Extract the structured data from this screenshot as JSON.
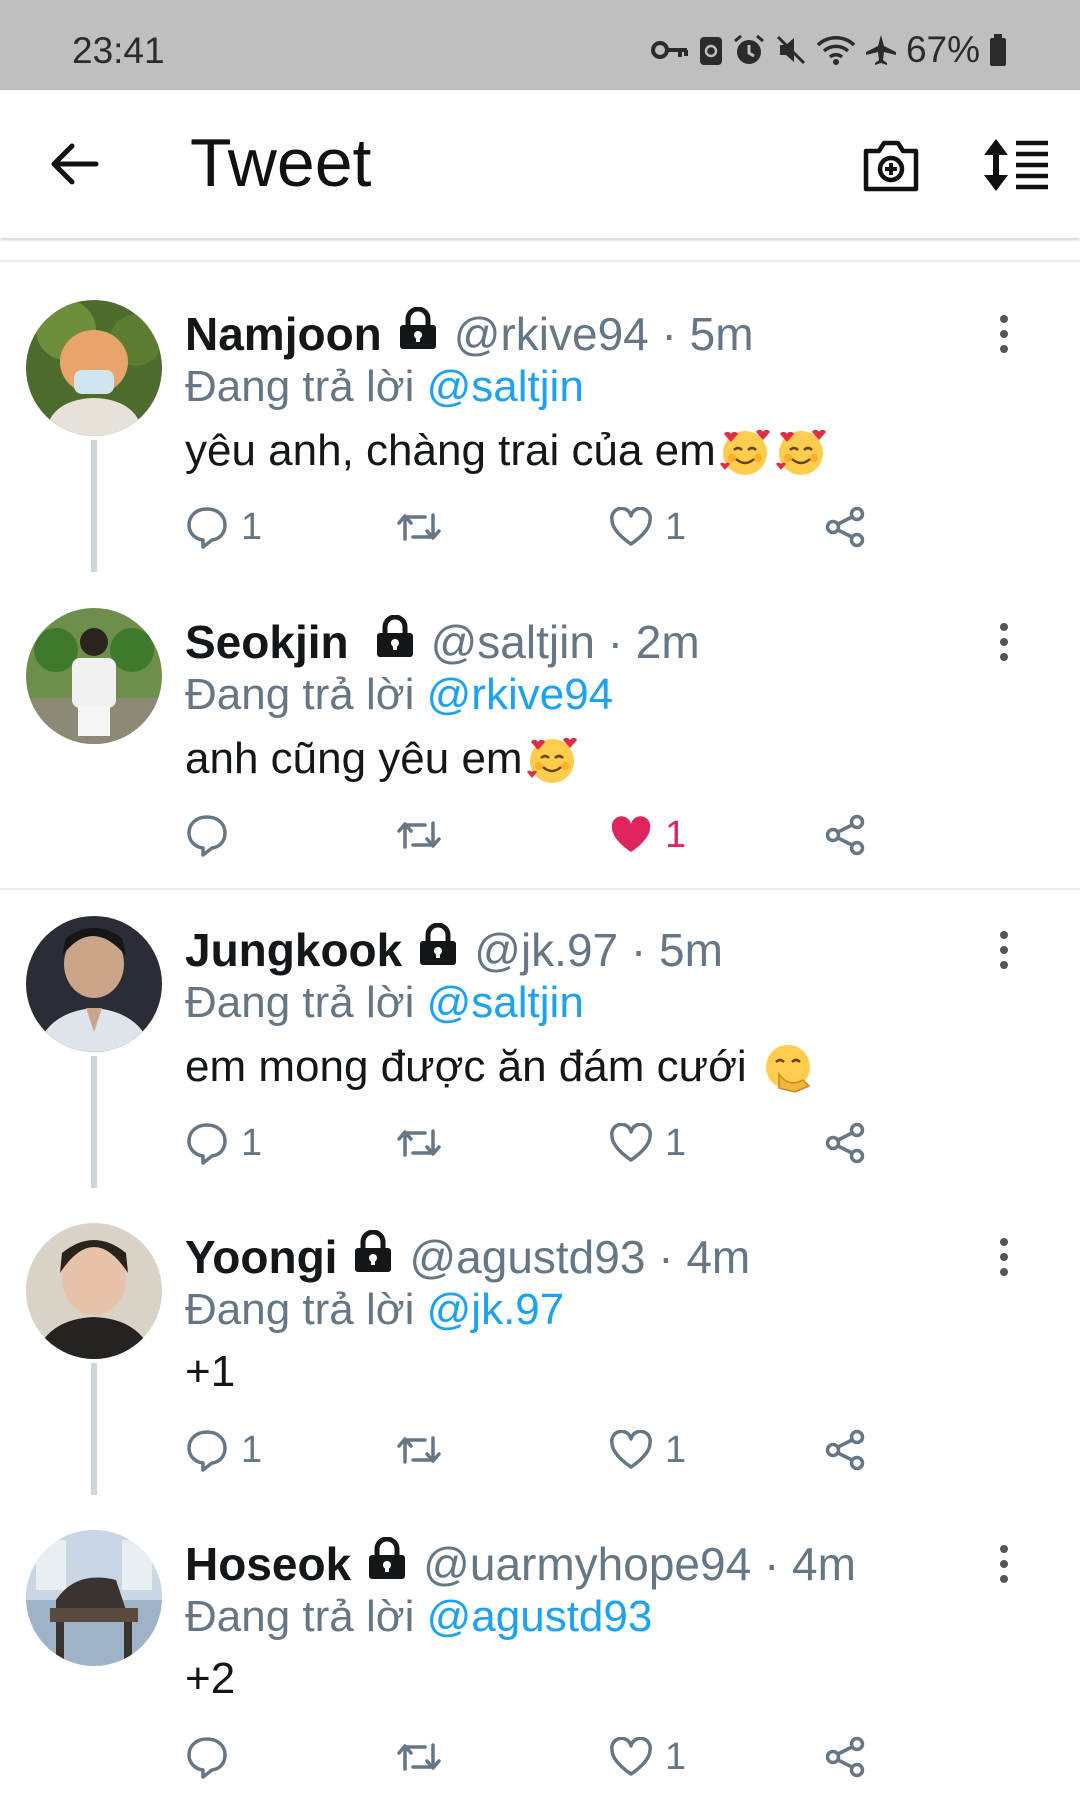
{
  "status_bar": {
    "time": "23:41",
    "battery": "67%"
  },
  "header": {
    "title": "Tweet"
  },
  "colors": {
    "accent": "#1da1f2",
    "like": "#e0245e",
    "muted": "#657786"
  },
  "tweets": [
    {
      "name": "Namjoon",
      "handle": "@rkive94",
      "time": "· 5m",
      "reply_prefix": "Đang trả lời",
      "reply_to": "@saltjin",
      "text": "yêu anh, chàng trai của em",
      "emoji": [
        "smiling-face-with-hearts",
        "smiling-face-with-hearts"
      ],
      "replies": "1",
      "retweets": "",
      "likes": "1",
      "liked": false,
      "thread": true
    },
    {
      "name": "Seokjin",
      "handle": "@saltjin",
      "time": "· 2m",
      "reply_prefix": "Đang trả lời",
      "reply_to": "@rkive94",
      "text": "anh cũng yêu em",
      "emoji": [
        "smiling-face-with-hearts"
      ],
      "replies": "",
      "retweets": "",
      "likes": "1",
      "liked": true,
      "thread": false
    },
    {
      "name": "Jungkook",
      "handle": "@jk.97",
      "time": "· 5m",
      "reply_prefix": "Đang trả lời",
      "reply_to": "@saltjin",
      "text": "em mong được ăn đám cưới ",
      "emoji": [
        "face-with-hand-over-mouth"
      ],
      "replies": "1",
      "retweets": "",
      "likes": "1",
      "liked": false,
      "thread": true
    },
    {
      "name": "Yoongi",
      "handle": "@agustd93",
      "time": "· 4m",
      "reply_prefix": "Đang trả lời",
      "reply_to": "@jk.97",
      "text": "+1",
      "emoji": [],
      "replies": "1",
      "retweets": "",
      "likes": "1",
      "liked": false,
      "thread": true
    },
    {
      "name": "Hoseok",
      "handle": "@uarmyhope94",
      "time": "· 4m",
      "reply_prefix": "Đang trả lời",
      "reply_to": "@agustd93",
      "text": "+2",
      "emoji": [],
      "replies": "",
      "retweets": "",
      "likes": "1",
      "liked": false,
      "thread": false
    }
  ]
}
